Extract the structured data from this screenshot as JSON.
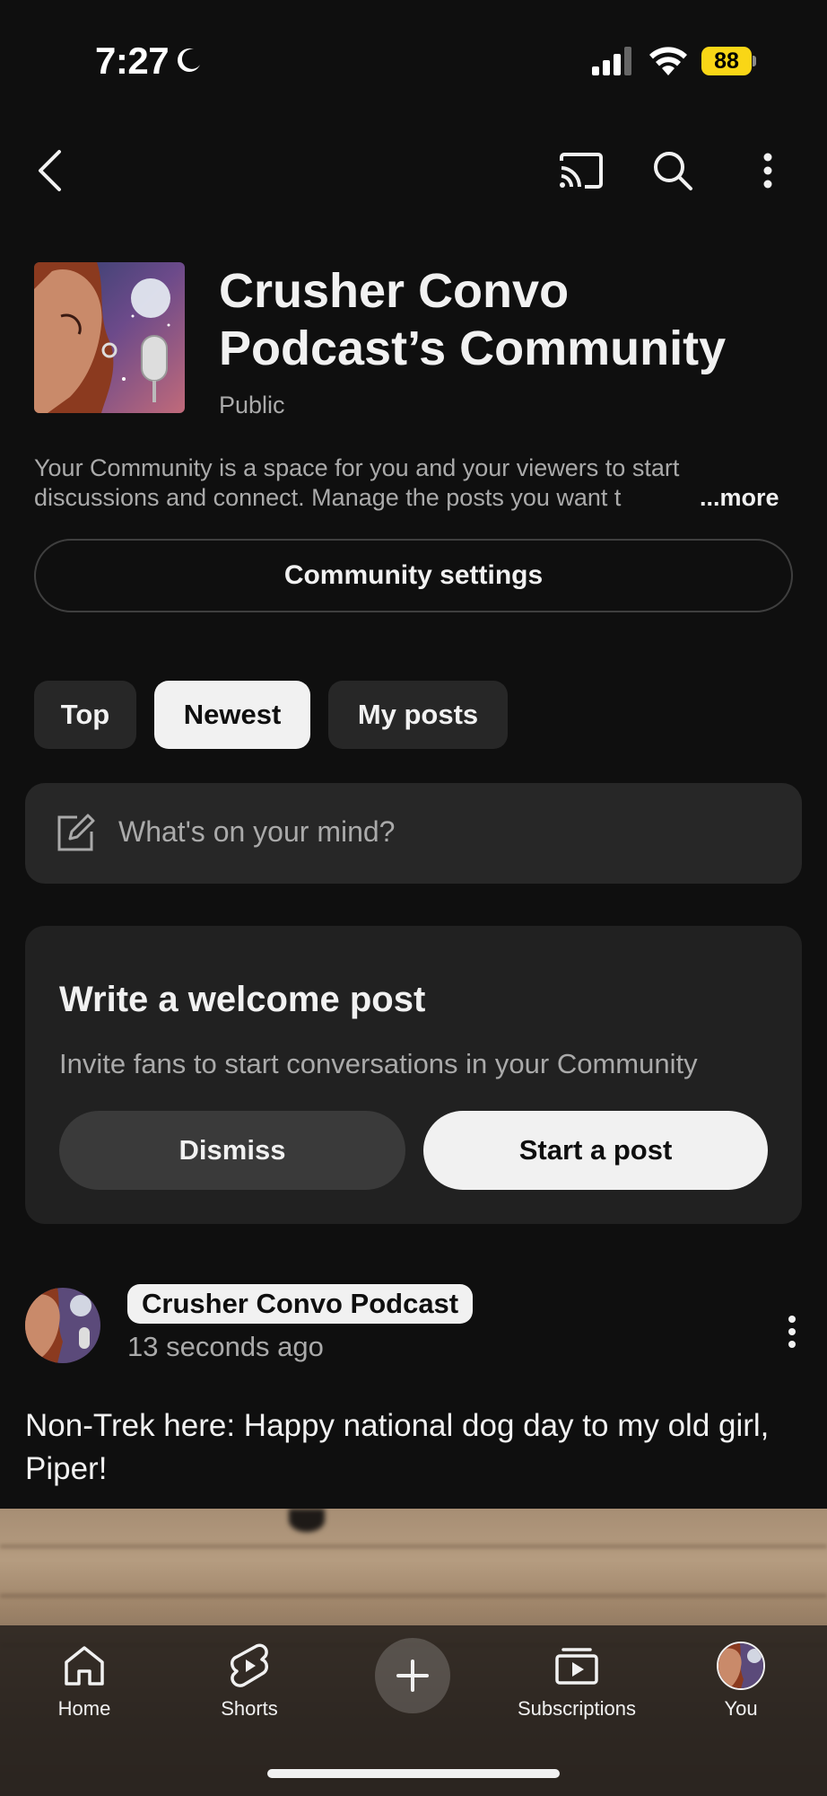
{
  "status_bar": {
    "time": "7:27",
    "battery": "88",
    "icons": [
      "moon-icon",
      "signal-icon",
      "wifi-icon",
      "battery-icon"
    ]
  },
  "top_nav": {
    "icons": [
      "back-icon",
      "cast-icon",
      "search-icon",
      "more-vertical-icon"
    ]
  },
  "community": {
    "title": "Crusher Convo Podcast’s Community",
    "visibility": "Public",
    "description_line1": "Your Community is a space for you and your viewers to start",
    "description_line2": "discussions and connect. Manage the posts you want t",
    "more_label": "...more",
    "settings_label": "Community settings"
  },
  "filters": {
    "chips": [
      {
        "label": "Top",
        "active": false
      },
      {
        "label": "Newest",
        "active": true
      },
      {
        "label": "My posts",
        "active": false
      }
    ]
  },
  "composer": {
    "placeholder": "What's on your mind?",
    "icon": "edit-icon"
  },
  "welcome_card": {
    "title": "Write a welcome post",
    "subtitle": "Invite fans to start conversations in your Community",
    "dismiss_label": "Dismiss",
    "start_label": "Start a post"
  },
  "post": {
    "author": "Crusher Convo Podcast",
    "time": "13 seconds ago",
    "text": "Non-Trek here: Happy national dog day to my old girl, Piper!"
  },
  "bottom_nav": {
    "items": [
      {
        "label": "Home",
        "icon": "home-icon"
      },
      {
        "label": "Shorts",
        "icon": "shorts-icon"
      },
      {
        "label": "",
        "icon": "plus-icon"
      },
      {
        "label": "Subscriptions",
        "icon": "subscriptions-icon"
      },
      {
        "label": "You",
        "icon": "avatar"
      }
    ]
  },
  "colors": {
    "background": "#0f0f0f",
    "surface": "#272727",
    "card": "#212121",
    "text_primary": "#f1f1f1",
    "text_secondary": "#aaaaaa",
    "battery": "#f9d616"
  }
}
